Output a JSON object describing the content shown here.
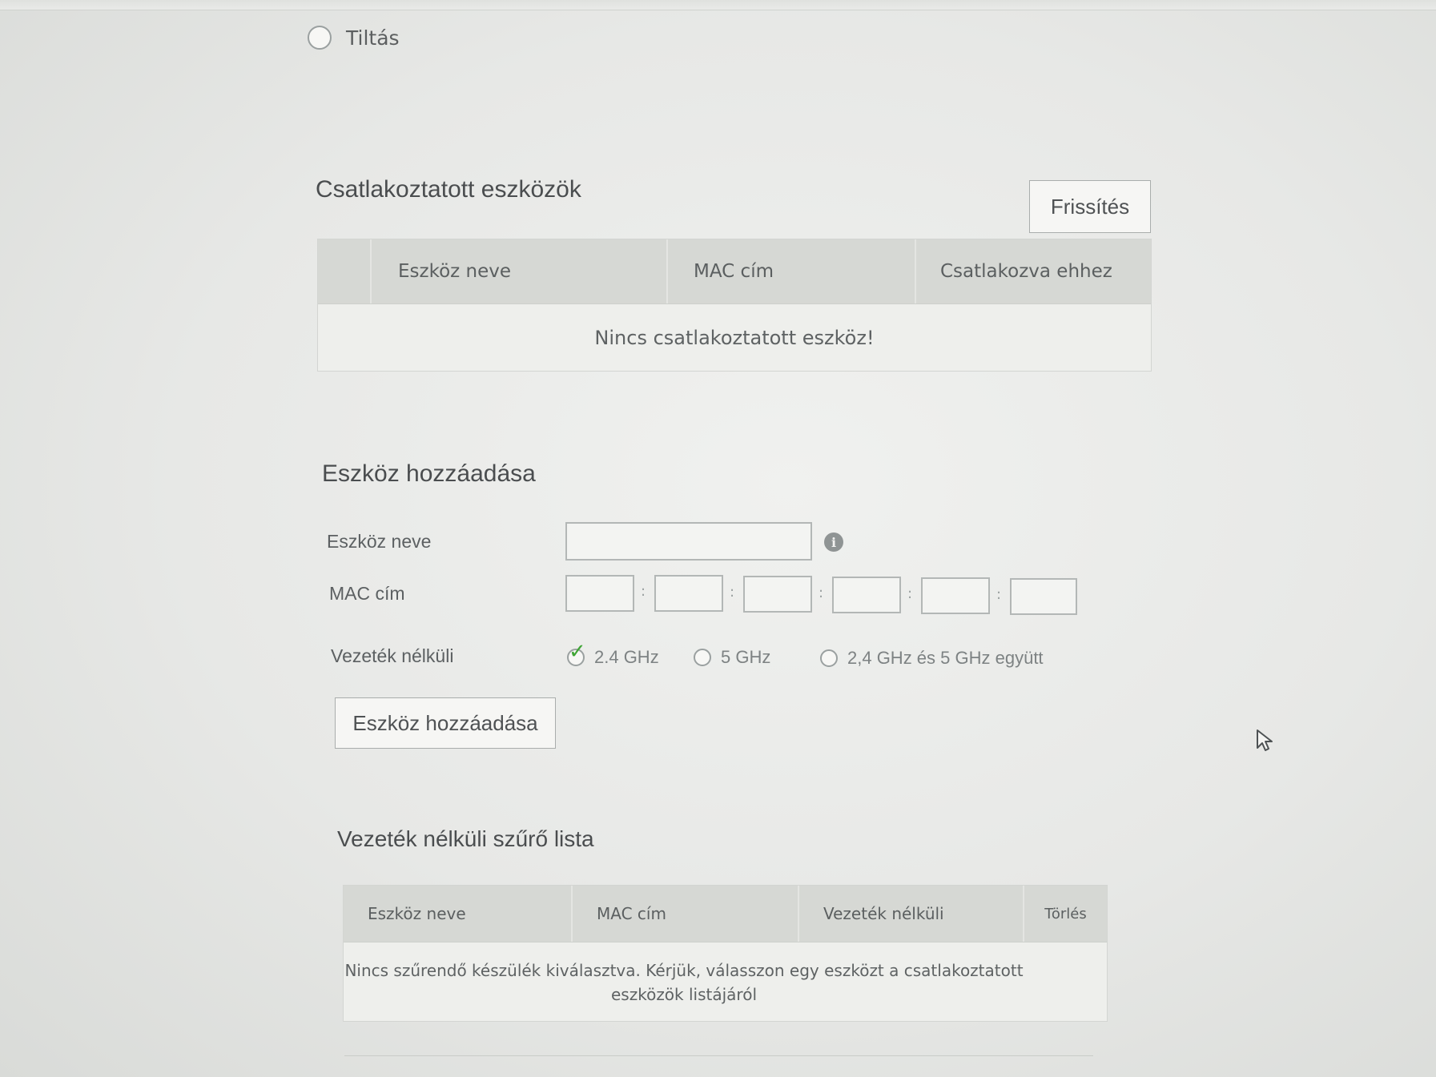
{
  "access_mode": {
    "disable_label": "Tiltás"
  },
  "connected_devices": {
    "title": "Csatlakoztatott eszközök",
    "refresh_button": "Frissítés",
    "columns": [
      "Eszköz neve",
      "MAC cím",
      "Csatlakozva ehhez"
    ],
    "empty_message": "Nincs csatlakoztatott eszköz!"
  },
  "add_device": {
    "title": "Eszköz hozzáadása",
    "name_label": "Eszköz neve",
    "name_value": "",
    "mac_label": "MAC cím",
    "mac_values": [
      "",
      "",
      "",
      "",
      "",
      ""
    ],
    "mac_separator": ":",
    "wireless_label": "Vezeték nélküli",
    "wireless_options": [
      "2.4 GHz",
      "5 GHz",
      "2,4 GHz és 5 GHz együtt"
    ],
    "wireless_selected": "2.4 GHz",
    "submit_button": "Eszköz hozzáadása"
  },
  "filter_list": {
    "title": "Vezeték nélküli szűrő lista",
    "columns": [
      "Eszköz neve",
      "MAC cím",
      "Vezeték nélküli",
      "Törlés"
    ],
    "empty_message_line1": "Nincs szűrendő készülék kiválasztva. Kérjük, válasszon egy eszközt a csatlakoztatott",
    "empty_message_line2": "eszközök listájáról"
  },
  "colors": {
    "check_green": "#3fa535",
    "header_gray": "#d6d8d4"
  }
}
